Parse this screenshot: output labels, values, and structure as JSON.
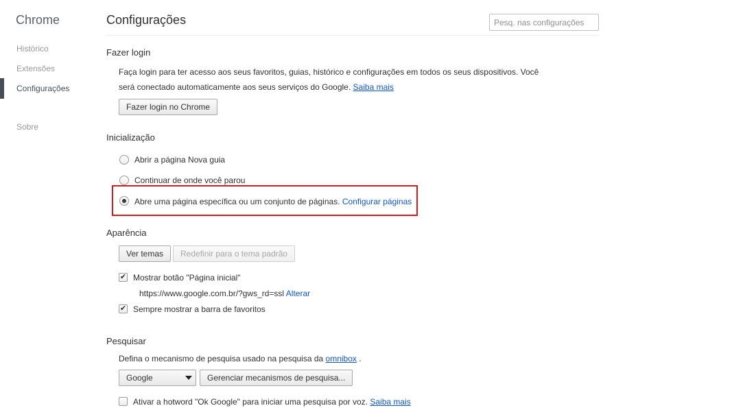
{
  "sidebar": {
    "app_title": "Chrome",
    "items": [
      {
        "label": "Histórico"
      },
      {
        "label": "Extensões"
      },
      {
        "label": "Configurações"
      },
      {
        "label": "Sobre"
      }
    ]
  },
  "header": {
    "title": "Configurações",
    "search_placeholder": "Pesq. nas configurações"
  },
  "signin": {
    "title": "Fazer login",
    "text_line1": "Faça login para ter acesso aos seus favoritos, guias, histórico e configurações em todos os seus dispositivos. Você",
    "text_line2": "será conectado automaticamente aos seus serviços do Google.",
    "learn_more": "Saiba mais",
    "button": "Fazer login no Chrome"
  },
  "startup": {
    "title": "Inicialização",
    "options": [
      {
        "label": "Abrir a página Nova guia",
        "checked": false
      },
      {
        "label": "Continuar de onde você parou",
        "checked": false
      },
      {
        "label": "Abre uma página específica ou um conjunto de páginas.",
        "checked": true
      }
    ],
    "configure_link": "Configurar páginas",
    "highlight_color": "#d11c24"
  },
  "appearance": {
    "title": "Aparência",
    "themes_button": "Ver temas",
    "reset_button": "Redefinir para o tema padrão",
    "show_home": "Mostrar botão \"Página inicial\"",
    "home_url": "https://www.google.com.br/?gws_rd=ssl",
    "change_link": "Alterar",
    "show_bookmarks": "Sempre mostrar a barra de favoritos"
  },
  "search": {
    "title": "Pesquisar",
    "description": "Defina o mecanismo de pesquisa usado na pesquisa da",
    "omnibox_link": "omnibox",
    "period": ".",
    "engine_selected": "Google",
    "manage_button": "Gerenciar mecanismos de pesquisa...",
    "hotword_text": "Ativar a hotword \"Ok Google\" para iniciar uma pesquisa por voz.",
    "hotword_learn_more": "Saiba mais"
  }
}
